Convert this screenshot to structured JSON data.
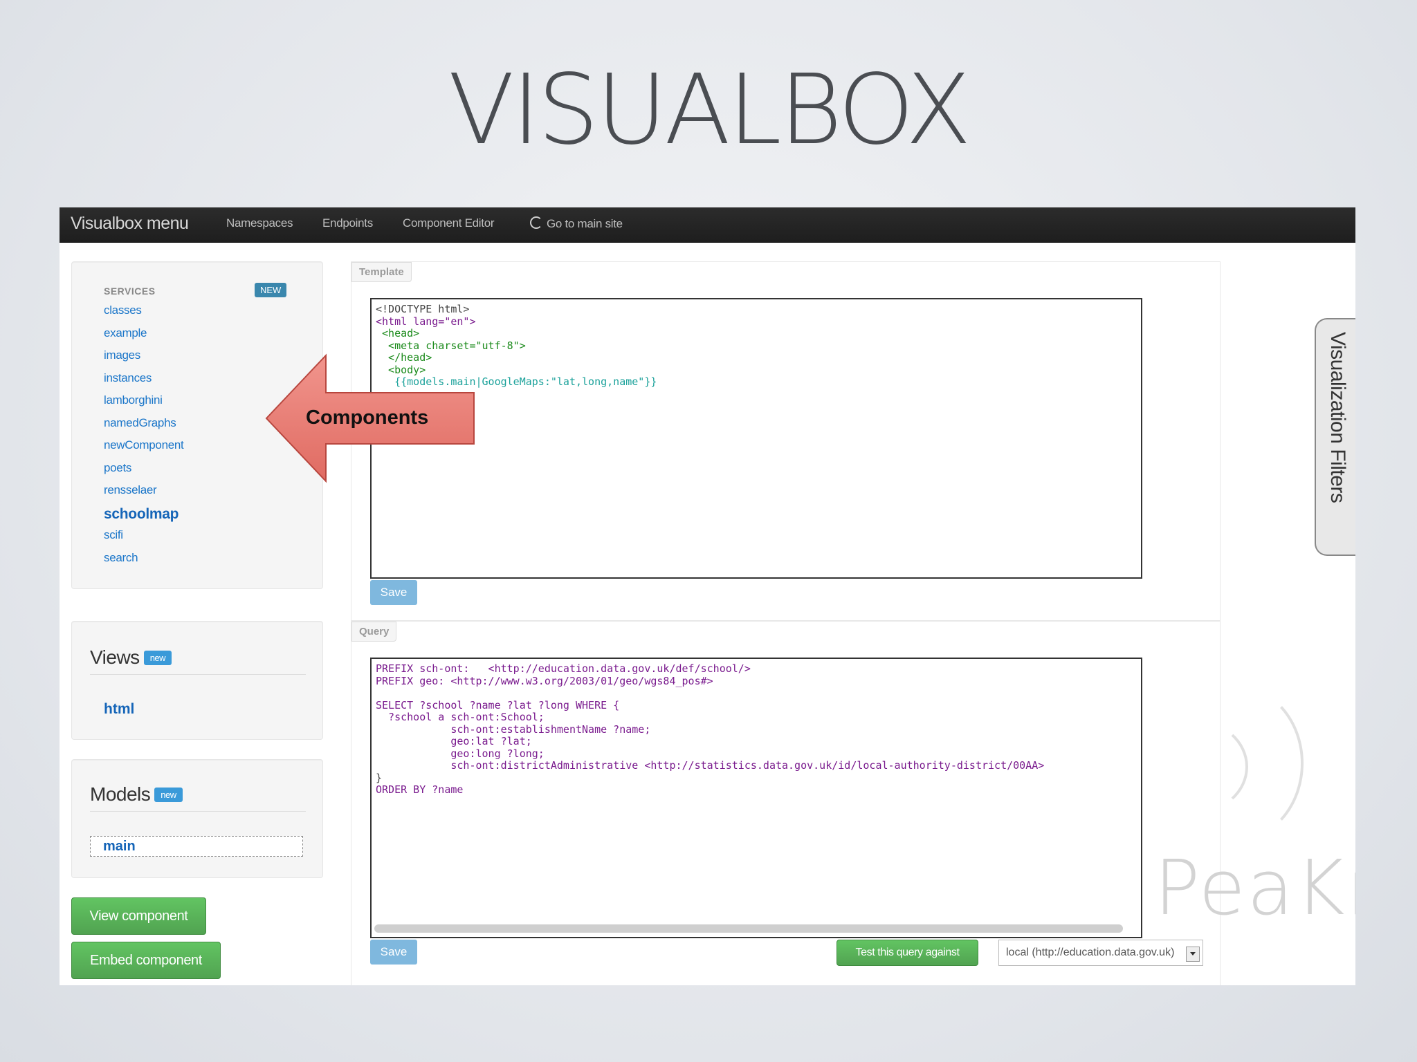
{
  "slide_title": "VISUALBOX",
  "navbar": {
    "brand": "Visualbox menu",
    "items": [
      "Namespaces",
      "Endpoints",
      "Component Editor",
      "Go to main site"
    ]
  },
  "sidebar": {
    "services_heading": "SERVICES",
    "services_badge": "NEW",
    "services": [
      "classes",
      "example",
      "images",
      "instances",
      "lamborghini",
      "namedGraphs",
      "newComponent",
      "poets",
      "rensselaer",
      "schoolmap",
      "scifi",
      "search"
    ],
    "active_service": "schoolmap",
    "views": {
      "heading": "Views",
      "badge": "new",
      "items": [
        "html"
      ]
    },
    "models": {
      "heading": "Models",
      "badge": "new",
      "value": "main"
    },
    "buttons": {
      "view": "View component",
      "embed": "Embed component"
    }
  },
  "template_panel": {
    "label": "Template",
    "lines": [
      "<!DOCTYPE html>",
      "<html lang=\"en\">",
      " <head>",
      "  <meta charset=\"utf-8\">",
      "  </head>",
      "  <body>",
      "   {{models.main|GoogleMaps:\"lat,long,name\"}}"
    ],
    "save_label": "Save"
  },
  "query_panel": {
    "label": "Query",
    "lines": [
      "PREFIX sch-ont:   <http://education.data.gov.uk/def/school/>",
      "PREFIX geo: <http://www.w3.org/2003/01/geo/wgs84_pos#>",
      "",
      "SELECT ?school ?name ?lat ?long WHERE {",
      "  ?school a sch-ont:School;",
      "            sch-ont:establishmentName ?name;",
      "            geo:lat ?lat;",
      "            geo:long ?long;",
      "            sch-ont:districtAdministrative <http://statistics.data.gov.uk/id/local-authority-district/00AA>",
      "}",
      "ORDER BY ?name"
    ],
    "save_label": "Save",
    "test_label": "Test this query against",
    "endpoint_value": "local (http://education.data.gov.uk)"
  },
  "filters_tab": "Visualization Filters",
  "watermark": "PeaKr",
  "callout": "Components",
  "colors": {
    "navbar": "#222222",
    "link": "#1b76c9",
    "badge": "#3a87ad",
    "green_button": "#5bb75b",
    "save_button": "#7fb8de",
    "callout_fill": "#e8736c"
  }
}
